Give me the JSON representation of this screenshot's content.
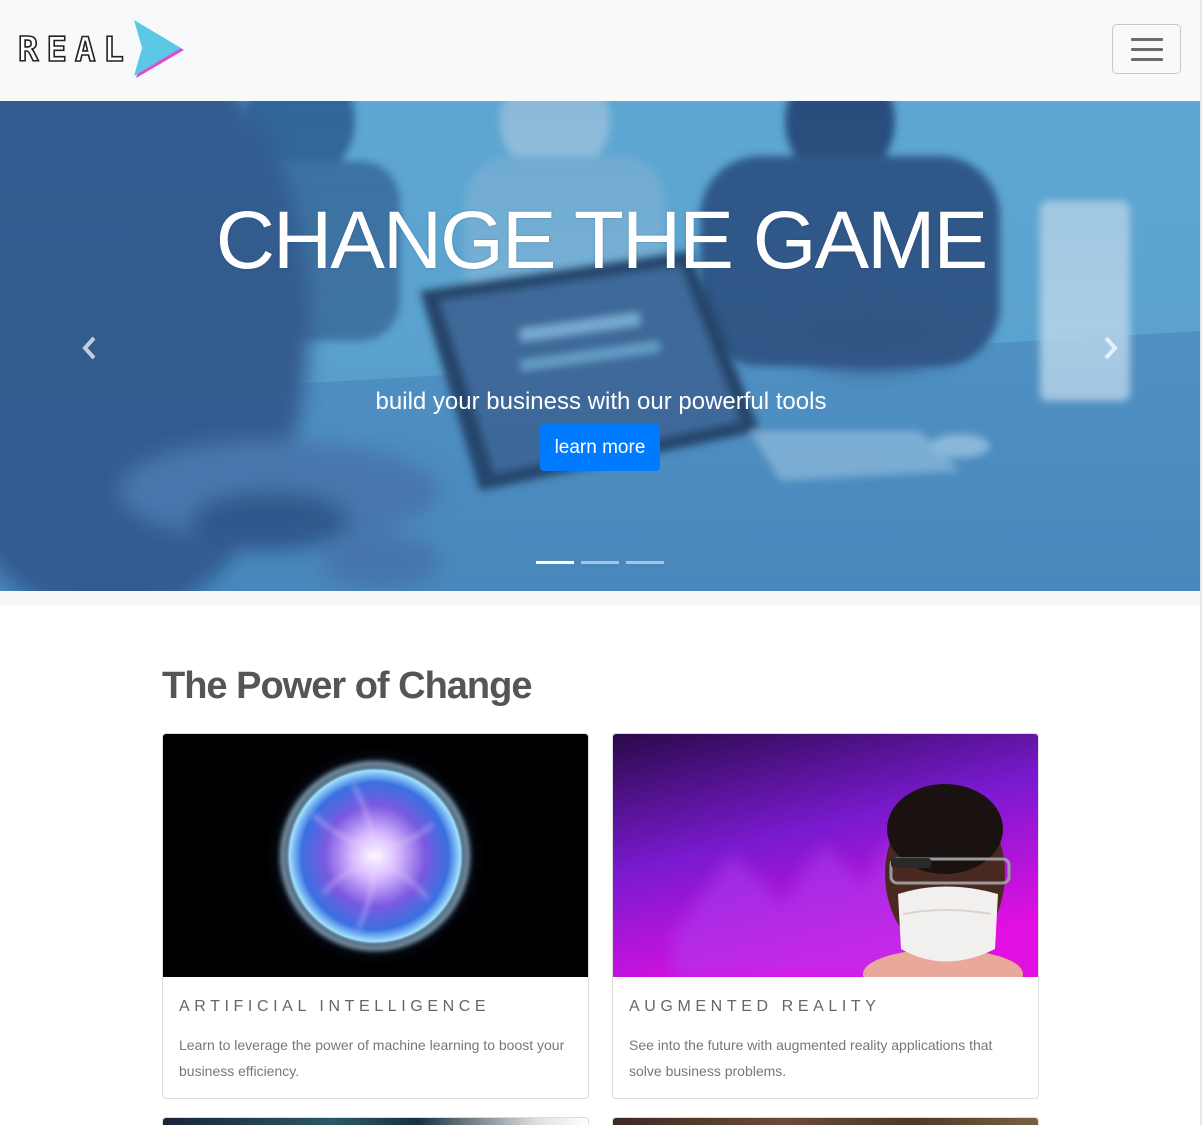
{
  "navbar": {
    "brand_text": "REAL",
    "brand_color_primary": "#5bc8e8",
    "brand_color_outline": "#e04ad0",
    "menu_icon": "hamburger-icon"
  },
  "hero": {
    "title": "CHANGE THE GAME",
    "subtitle": "build your business with our powerful tools",
    "button_label": "learn more",
    "prev_icon": "chevron-left-icon",
    "next_icon": "chevron-right-icon",
    "slide_count": 3,
    "active_slide": 1,
    "tint_color": "#5aa2c8",
    "button_color": "#007bff"
  },
  "section": {
    "title": "The Power of Change"
  },
  "cards": [
    {
      "title": "ARTIFICIAL INTELLIGENCE",
      "text": "Learn to leverage the power of machine learning to boost your business efficiency."
    },
    {
      "title": "AUGMENTED REALITY",
      "text": "See into the future with augmented reality applications that solve business problems."
    }
  ]
}
